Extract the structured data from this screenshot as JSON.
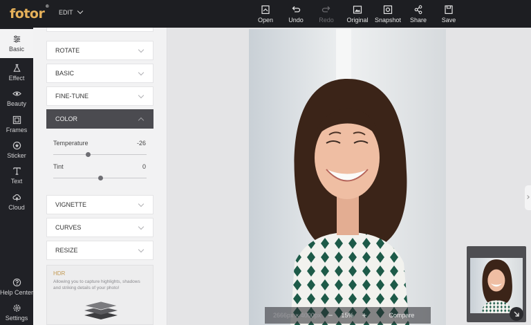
{
  "app": {
    "logo_text": "fotor",
    "logo_mark": "®",
    "mode_label": "EDIT"
  },
  "toolbar": [
    {
      "label": "Open",
      "icon": "open-icon",
      "enabled": true
    },
    {
      "label": "Undo",
      "icon": "undo-icon",
      "enabled": true
    },
    {
      "label": "Redo",
      "icon": "redo-icon",
      "enabled": false
    },
    {
      "label": "Original",
      "icon": "original-icon",
      "enabled": true
    },
    {
      "label": "Snapshot",
      "icon": "snapshot-icon",
      "enabled": true
    },
    {
      "label": "Share",
      "icon": "share-icon",
      "enabled": true
    },
    {
      "label": "Save",
      "icon": "save-icon",
      "enabled": true
    }
  ],
  "rail": [
    {
      "label": "Basic",
      "icon": "sliders-icon",
      "active": true
    },
    {
      "label": "Effect",
      "icon": "flask-icon"
    },
    {
      "label": "Beauty",
      "icon": "eye-icon"
    },
    {
      "label": "Frames",
      "icon": "frame-icon"
    },
    {
      "label": "Sticker",
      "icon": "sticker-icon"
    },
    {
      "label": "Text",
      "icon": "text-icon"
    },
    {
      "label": "Cloud",
      "icon": "cloud-icon"
    }
  ],
  "rail_bottom": [
    {
      "label": "Help Center",
      "icon": "help-icon"
    },
    {
      "label": "Settings",
      "icon": "settings-icon"
    }
  ],
  "panel": {
    "sections": [
      "ROTATE",
      "BASIC",
      "FINE-TUNE",
      "COLOR",
      "VIGNETTE",
      "CURVES",
      "RESIZE"
    ],
    "open_section": "COLOR",
    "color": {
      "temperature_label": "Temperature",
      "temperature_value": "-26",
      "temperature_level": 0.37,
      "tint_label": "Tint",
      "tint_value": "0",
      "tint_level": 0.5
    },
    "hdr": {
      "title": "HDR",
      "description": "Allowing you to capture highlights, shadows and striking details of your photo!"
    }
  },
  "canvas": {
    "dimensions": "2666px × 4000px",
    "zoom_out": "−",
    "zoom_pct": "15%",
    "zoom_in": "+",
    "compare_label": "Compare"
  },
  "colors": {
    "accent": "#e6b15a",
    "topbar": "#1d1e22",
    "panel_open": "#4b4b50"
  }
}
